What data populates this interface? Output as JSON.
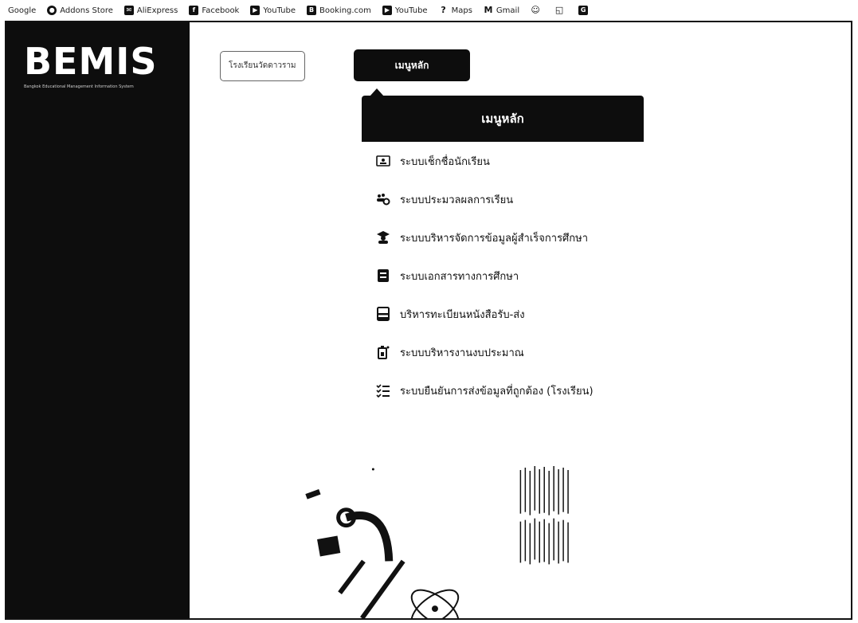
{
  "bookmarks": [
    {
      "label": "Google",
      "icon": "none"
    },
    {
      "label": "Addons Store",
      "icon": "addons-icon"
    },
    {
      "label": "AliExpress",
      "icon": "aliexpress-icon"
    },
    {
      "label": "Facebook",
      "icon": "facebook-icon"
    },
    {
      "label": "YouTube",
      "icon": "youtube-icon"
    },
    {
      "label": "Booking.com",
      "icon": "booking-icon"
    },
    {
      "label": "YouTube",
      "icon": "youtube-icon"
    },
    {
      "label": "Maps",
      "icon": "maps-icon"
    },
    {
      "label": "Gmail",
      "icon": "gmail-icon"
    },
    {
      "label": "",
      "icon": "app-icon"
    },
    {
      "label": "",
      "icon": "app-icon"
    },
    {
      "label": "",
      "icon": "app-icon"
    }
  ],
  "sidebar": {
    "logo": "BEMIS",
    "subtitle": "Bangkok Educational Management Information System"
  },
  "top": {
    "school_button": "โรงเรียนวัดดาวราม",
    "main_menu_button": "เมนูหลัก"
  },
  "dropdown": {
    "title": "เมนูหลัก",
    "items": [
      {
        "label": "ระบบเช็กชื่อนักเรียน",
        "icon": "id-card-icon"
      },
      {
        "label": "ระบบประมวลผลการเรียน",
        "icon": "users-gear-icon"
      },
      {
        "label": "ระบบบริหารจัดการข้อมูลผู้สำเร็จการศึกษา",
        "icon": "graduate-icon"
      },
      {
        "label": "ระบบเอกสารทางการศึกษา",
        "icon": "document-icon"
      },
      {
        "label": "บริหารทะเบียนหนังสือรับ-ส่ง",
        "icon": "book-register-icon"
      },
      {
        "label": "ระบบบริหารงานงบประมาณ",
        "icon": "budget-icon"
      },
      {
        "label": "ระบบยืนยันการส่งข้อมูลที่ถูกต้อง (โรงเรียน)",
        "icon": "checklist-icon"
      }
    ]
  },
  "colors": {
    "sidebar_bg": "#0d0d0d",
    "header_bg": "#0d0d0d",
    "text": "#111111"
  }
}
